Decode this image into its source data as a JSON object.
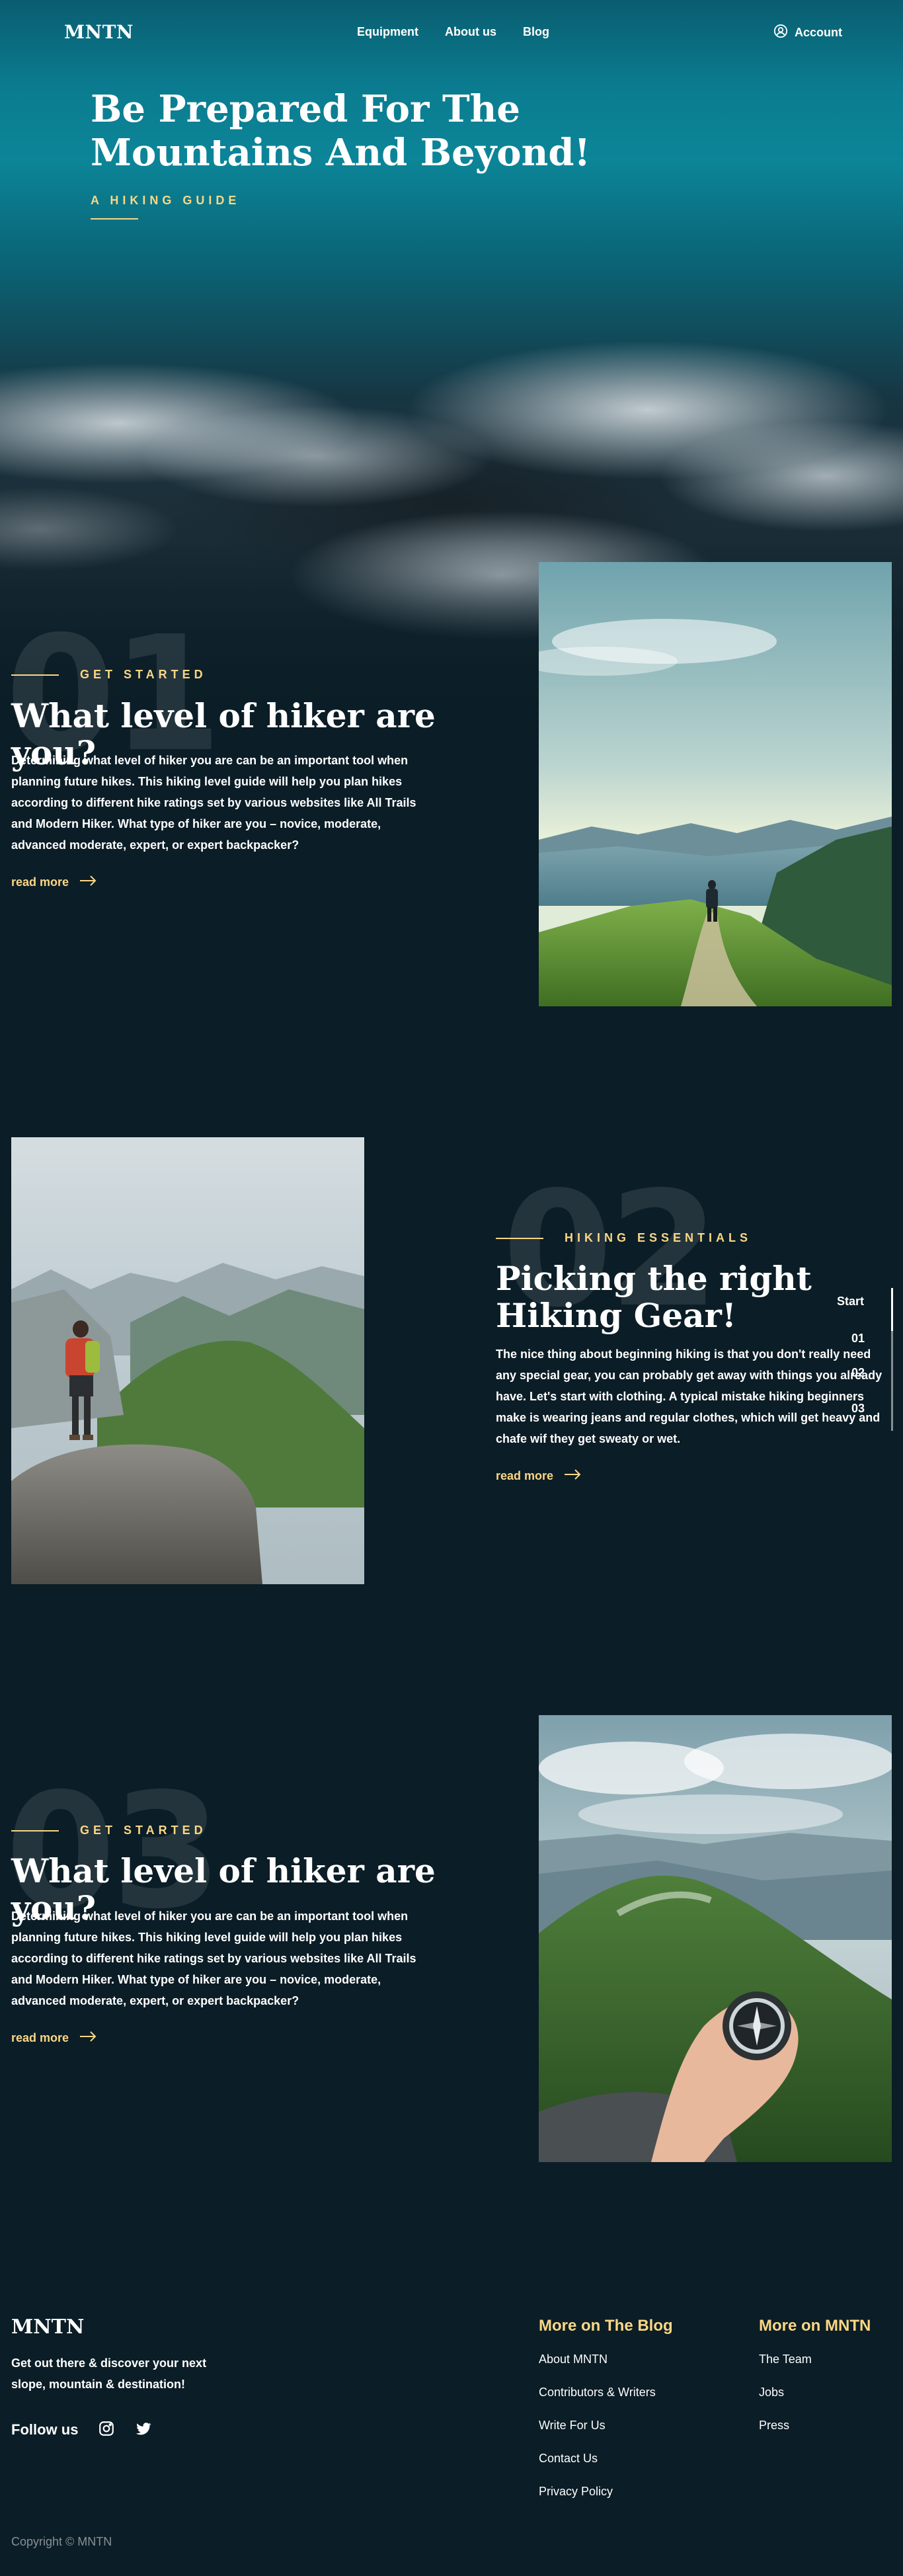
{
  "nav": {
    "logo": "MNTN",
    "links": [
      "Equipment",
      "About us",
      "Blog"
    ],
    "account_label": "Account"
  },
  "hero": {
    "title": "Be Prepared For The Mountains And Beyond!",
    "subtitle": "A HIKING GUIDE"
  },
  "sections": [
    {
      "number": "01",
      "eyebrow": "GET STARTED",
      "title": "What level of hiker are you?",
      "body": "Determining what level of hiker you are can be an important tool when planning future hikes. This hiking level guide will help you plan hikes according to different hike ratings set by various websites like All Trails and Modern Hiker. What type of hiker are you – novice, moderate, advanced moderate, expert, or expert backpacker?",
      "read_more": "read more"
    },
    {
      "number": "02",
      "eyebrow": "HIKING ESSENTIALS",
      "title": "Picking the right Hiking Gear!",
      "body": "The nice thing about beginning hiking is that you don't really need any special gear, you can probably get away with things you already have. Let's start with clothing. A typical mistake hiking beginners make is wearing jeans and regular clothes, which will get heavy and chafe wif they get sweaty or wet.",
      "read_more": "read more"
    },
    {
      "number": "03",
      "eyebrow": "GET STARTED",
      "title": "What level of hiker are you?",
      "body": "Determining what level of hiker you are can be an important tool when planning future hikes. This hiking level guide will help you plan hikes according to different hike ratings set by various websites like All Trails and Modern Hiker. What type of hiker are you – novice, moderate, advanced moderate, expert, or expert backpacker?",
      "read_more": "read more"
    }
  ],
  "side_nav": {
    "start_label": "Start",
    "items": [
      "01",
      "02",
      "03"
    ],
    "progress": 0.3
  },
  "footer": {
    "logo": "MNTN",
    "tagline": "Get out there & discover your next slope, mountain & destination!",
    "follow_label": "Follow us",
    "blog_title": "More on The Blog",
    "blog_links": [
      "About MNTN",
      "Contributors & Writers",
      "Write For Us",
      "Contact Us",
      "Privacy Policy"
    ],
    "mntn_title": "More on MNTN",
    "mntn_links": [
      "The Team",
      "Jobs",
      "Press"
    ],
    "copyright": "Copyright © MNTN"
  },
  "colors": {
    "background": "#0b1d26",
    "accent": "#fbd784",
    "text": "#ffffff"
  },
  "icons": [
    "user-icon",
    "arrow-right-icon",
    "instagram-icon",
    "twitter-icon"
  ]
}
